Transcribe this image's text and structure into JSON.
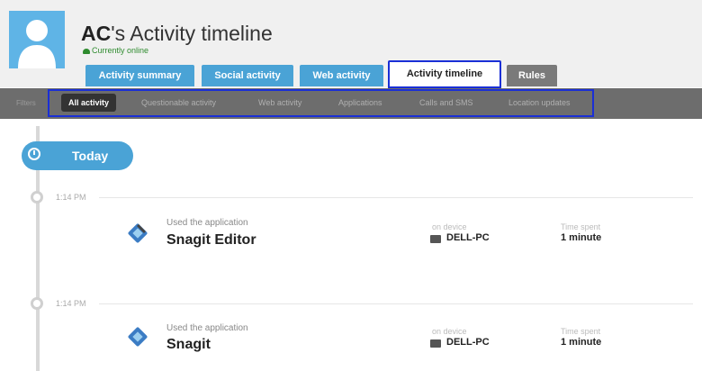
{
  "profile": {
    "title_bold": "AC",
    "title_rest": "'s Activity timeline",
    "status": "Currently online",
    "avatar_icon": "user-silhouette-icon"
  },
  "tabs": [
    {
      "label": "Activity summary",
      "active": false
    },
    {
      "label": "Social activity",
      "active": false
    },
    {
      "label": "Web activity",
      "active": false
    },
    {
      "label": "Activity timeline",
      "active": true
    },
    {
      "label": "Rules",
      "active": false
    }
  ],
  "filters": {
    "label": "Filters",
    "items": [
      {
        "label": "All activity",
        "selected": true
      },
      {
        "label": "Questionable activity",
        "selected": false
      },
      {
        "label": "Web activity",
        "selected": false
      },
      {
        "label": "Applications",
        "selected": false
      },
      {
        "label": "Calls and SMS",
        "selected": false
      },
      {
        "label": "Location updates",
        "selected": false
      }
    ]
  },
  "timeline": {
    "today_label": "Today",
    "entries": [
      {
        "time": "1:14 PM",
        "action": "Used the application",
        "app": "Snagit Editor",
        "device_label": "on device",
        "device": "DELL-PC",
        "spent_label": "Time spent",
        "spent": "1 minute"
      },
      {
        "time": "1:14 PM",
        "action": "Used the application",
        "app": "Snagit",
        "device_label": "on device",
        "device": "DELL-PC",
        "spent_label": "Time spent",
        "spent": "1 minute"
      }
    ]
  },
  "colors": {
    "accent_blue": "#4aa3d6",
    "highlight_border": "#1a2fd6",
    "online_green": "#2e8b2e"
  }
}
